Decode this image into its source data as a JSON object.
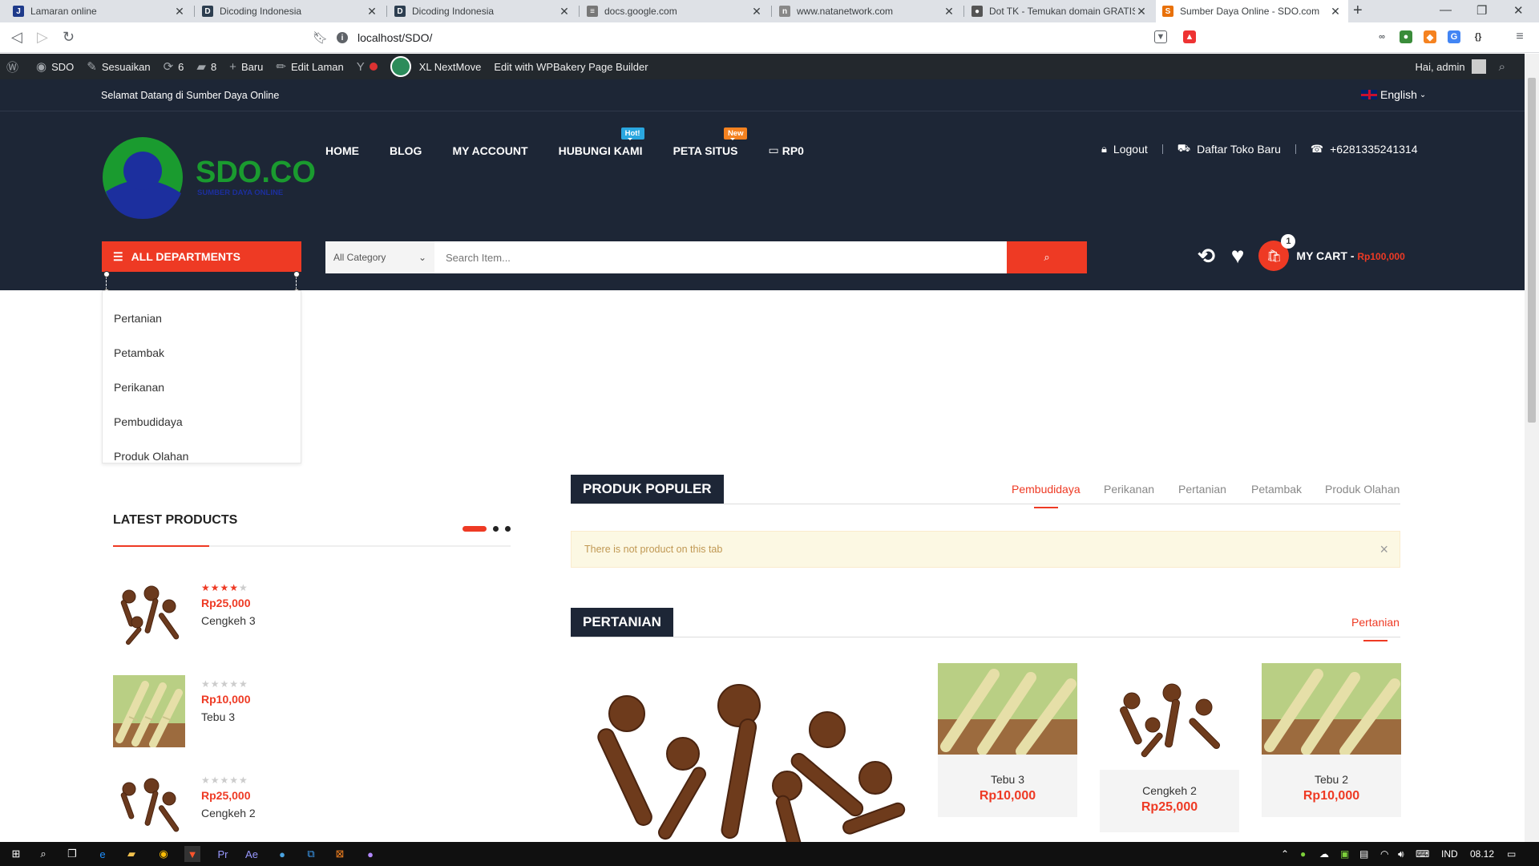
{
  "browser": {
    "tabs": [
      {
        "title": "Lamaran online",
        "fav_letter": "J",
        "fav_color": "#1e3a8a"
      },
      {
        "title": "Dicoding Indonesia",
        "fav_letter": "D",
        "fav_color": "#2d3e50"
      },
      {
        "title": "Dicoding Indonesia",
        "fav_letter": "D",
        "fav_color": "#2d3e50"
      },
      {
        "title": "docs.google.com",
        "fav_letter": "≡",
        "fav_color": "#777777"
      },
      {
        "title": "www.natanetwork.com",
        "fav_letter": "n",
        "fav_color": "#888888"
      },
      {
        "title": "Dot TK - Temukan domain GRATIS",
        "fav_letter": "●",
        "fav_color": "#555555"
      },
      {
        "title": "Sumber Daya Online - SDO.com",
        "fav_letter": "S",
        "fav_color": "#e8710a"
      }
    ],
    "url": "localhost/SDO/"
  },
  "adminbar": {
    "site": "SDO",
    "customize": "Sesuaikan",
    "updates": "6",
    "comments": "8",
    "new": "Baru",
    "edit": "Edit Laman",
    "nextmove": "XL NextMove",
    "wpbakery": "Edit with WPBakery Page Builder",
    "greeting": "Hai, admin"
  },
  "header": {
    "welcome": "Selamat Datang di Sumber Daya Online",
    "language": "English",
    "logo_text": "SDO.COM",
    "logo_sub": "SUMBER DAYA ONLINE",
    "nav": [
      {
        "label": "HOME",
        "badge": ""
      },
      {
        "label": "BLOG",
        "badge": ""
      },
      {
        "label": "MY ACCOUNT",
        "badge": ""
      },
      {
        "label": "HUBUNGI KAMI",
        "badge": "Hot!"
      },
      {
        "label": "PETA SITUS",
        "badge": "New"
      },
      {
        "label": "RP0",
        "badge": ""
      }
    ],
    "logout": "Logout",
    "new_store": "Daftar Toko Baru",
    "phone": "+6281335241314",
    "all_departments": "ALL DEPARTMENTS",
    "category": "All Category",
    "search_placeholder": "Search Item...",
    "cart_count": "1",
    "cart_label": "MY CART - ",
    "cart_amount": "Rp100,000"
  },
  "departments": [
    "Pertanian",
    "Petambak",
    "Perikanan",
    "Pembudidaya",
    "Produk Olahan"
  ],
  "latest": {
    "title": "LATEST PRODUCTS",
    "items": [
      {
        "name": "Cengkeh 3",
        "price": "Rp25,000",
        "rating": 4,
        "image": "cloves"
      },
      {
        "name": "Tebu 3",
        "price": "Rp10,000",
        "rating": 0,
        "image": "sugarcane"
      },
      {
        "name": "Cengkeh 2",
        "price": "Rp25,000",
        "rating": 0,
        "image": "cloves"
      }
    ]
  },
  "popular": {
    "title": "PRODUK POPULER",
    "tabs": [
      "Pembudidaya",
      "Perikanan",
      "Pertanian",
      "Petambak",
      "Produk Olahan"
    ],
    "active_tab": 0,
    "notice": "There is not product on this tab"
  },
  "pertanian": {
    "title": "PERTANIAN",
    "tab": "Pertanian",
    "products": [
      {
        "name": "Tebu 3",
        "price": "Rp10,000",
        "image": "sugarcane"
      },
      {
        "name": "Cengkeh 2",
        "price": "Rp25,000",
        "image": "cloves"
      },
      {
        "name": "Tebu 2",
        "price": "Rp10,000",
        "image": "sugarcane"
      }
    ]
  },
  "taskbar": {
    "lang": "IND",
    "time": "08.12"
  },
  "colors": {
    "accent": "#ee3a24",
    "header_bg": "#1d2636"
  }
}
